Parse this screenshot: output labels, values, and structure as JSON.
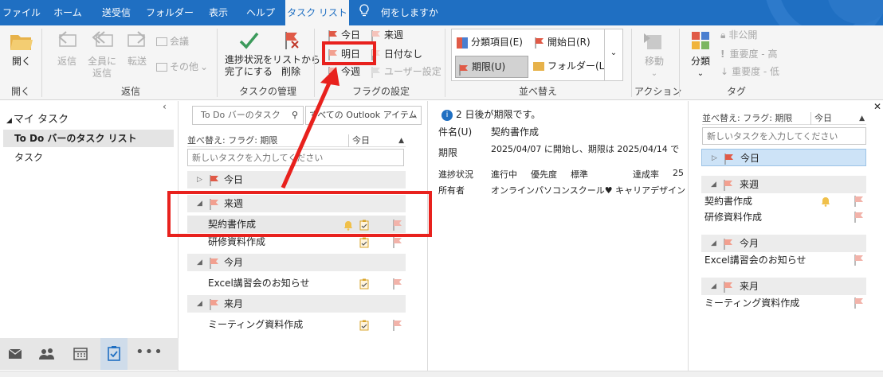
{
  "tabs": [
    "ファイル",
    "ホーム",
    "送受信",
    "フォルダー",
    "表示",
    "ヘルプ",
    "タスク リスト",
    "何をしますか"
  ],
  "ribbon": {
    "open": {
      "open_label": "開く",
      "group": "開く"
    },
    "respond": {
      "reply": "返信",
      "reply_all_l1": "全員に",
      "reply_all_l2": "返信",
      "forward": "転送",
      "meeting": "会議",
      "more": "その他",
      "group": "返信"
    },
    "manage": {
      "mark_complete_l1": "進捗状況を",
      "mark_complete_l2": "完了にする",
      "remove_l1": "リストから",
      "remove_l2": "削除",
      "group": "タスクの管理"
    },
    "flags": {
      "today": "今日",
      "tomorrow": "明日",
      "this_week": "今週",
      "next_week": "来週",
      "no_date": "日付なし",
      "custom": "ユーザー設定",
      "group": "フラグの設定"
    },
    "arrangement": {
      "categories": "分類項目(E)",
      "start_date": "開始日(R)",
      "due_date": "期限(U)",
      "folder": "フォルダー(L)",
      "group": "並べ替え"
    },
    "actions": {
      "move": "移動",
      "group": "アクション"
    },
    "tags": {
      "categorize": "分類",
      "private": "非公開",
      "high": "重要度 - 高",
      "low": "重要度 - 低",
      "group": "タグ"
    }
  },
  "nav": {
    "section_title": "マイ タスク",
    "items": [
      "To Do バーのタスク リスト",
      "タスク"
    ]
  },
  "tasklist": {
    "search_placeholder": "To Do バーのタスク",
    "scope": "すべての Outlook アイテム",
    "sort_label": "並べ替え: フラグ: 期限",
    "sort_value": "今日",
    "new_task_placeholder": "新しいタスクを入力してください",
    "groups": [
      {
        "name": "今日",
        "collapsed": true,
        "tasks": []
      },
      {
        "name": "来週",
        "collapsed": false,
        "tasks": [
          {
            "title": "契約書作成",
            "reminder": true,
            "selected": true
          },
          {
            "title": "研修資料作成",
            "reminder": false,
            "selected": false
          }
        ]
      },
      {
        "name": "今月",
        "collapsed": false,
        "tasks": [
          {
            "title": "Excel講習会のお知らせ",
            "reminder": false,
            "selected": false
          }
        ]
      },
      {
        "name": "来月",
        "collapsed": false,
        "tasks": [
          {
            "title": "ミーティング資料作成",
            "reminder": false,
            "selected": false
          }
        ]
      }
    ]
  },
  "reading": {
    "banner": "2 日後が期限です。",
    "subject_label": "件名(U)",
    "subject": "契約書作成",
    "due_label": "期限",
    "due": "2025/04/07 に開始し、期限は 2025/04/14 で",
    "status_label": "進捗状況",
    "status": "進行中",
    "priority_label": "優先度",
    "priority": "標準",
    "complete_label": "達成率",
    "complete": "25",
    "owner_label": "所有者",
    "owner": "オンラインパソコンスクール♥ キャリアデザイン"
  },
  "todobar": {
    "sort_label": "並べ替え: フラグ: 期限",
    "sort_value": "今日",
    "new_task_placeholder": "新しいタスクを入力してください",
    "groups": [
      {
        "name": "今日",
        "collapsed": true,
        "highlight": true,
        "tasks": []
      },
      {
        "name": "来週",
        "collapsed": false,
        "tasks": [
          {
            "title": "契約書作成",
            "reminder": true
          },
          {
            "title": "研修資料作成",
            "reminder": false
          }
        ]
      },
      {
        "name": "今月",
        "collapsed": false,
        "tasks": [
          {
            "title": "Excel講習会のお知らせ",
            "reminder": false
          }
        ]
      },
      {
        "name": "来月",
        "collapsed": false,
        "tasks": [
          {
            "title": "ミーティング資料作成",
            "reminder": false
          }
        ]
      }
    ]
  },
  "colors": {
    "ribbon_blue": "#1f6fc2",
    "flag_red": "#e05a47",
    "flag_pale": "#f2b3aa",
    "annotation_red": "#e8211d",
    "selected_bg": "#cde3f7"
  }
}
